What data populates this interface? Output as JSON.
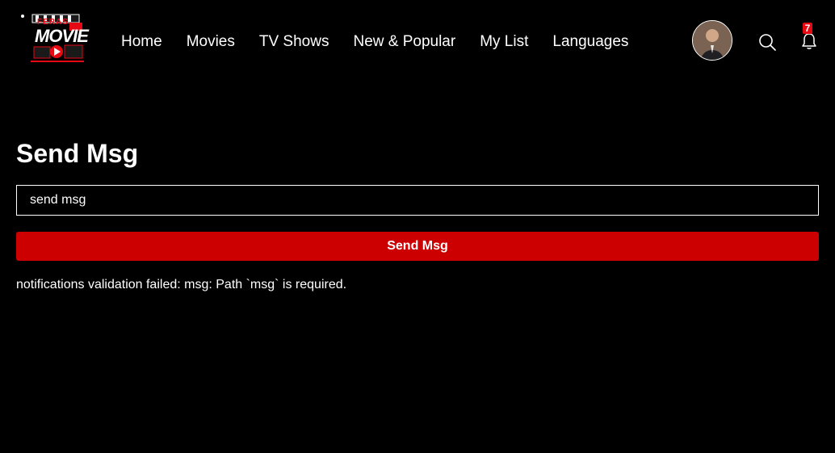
{
  "logo": {
    "top_text": "FERAS",
    "main_text": "MOVIE"
  },
  "nav": {
    "items": [
      {
        "label": "Home"
      },
      {
        "label": "Movies"
      },
      {
        "label": "TV Shows"
      },
      {
        "label": "New & Popular"
      },
      {
        "label": "My List"
      },
      {
        "label": "Languages"
      }
    ]
  },
  "header": {
    "avatar_icon": "user-avatar",
    "search_icon": "search-icon",
    "bell_icon": "bell-icon",
    "notification_count": "7"
  },
  "main": {
    "title": "Send Msg",
    "input_value": "send msg",
    "button_label": "Send Msg",
    "error_message": "notifications validation failed: msg: Path `msg` is required."
  },
  "colors": {
    "background": "#000000",
    "accent": "#cc0000",
    "badge": "#e50914",
    "text": "#ffffff"
  }
}
